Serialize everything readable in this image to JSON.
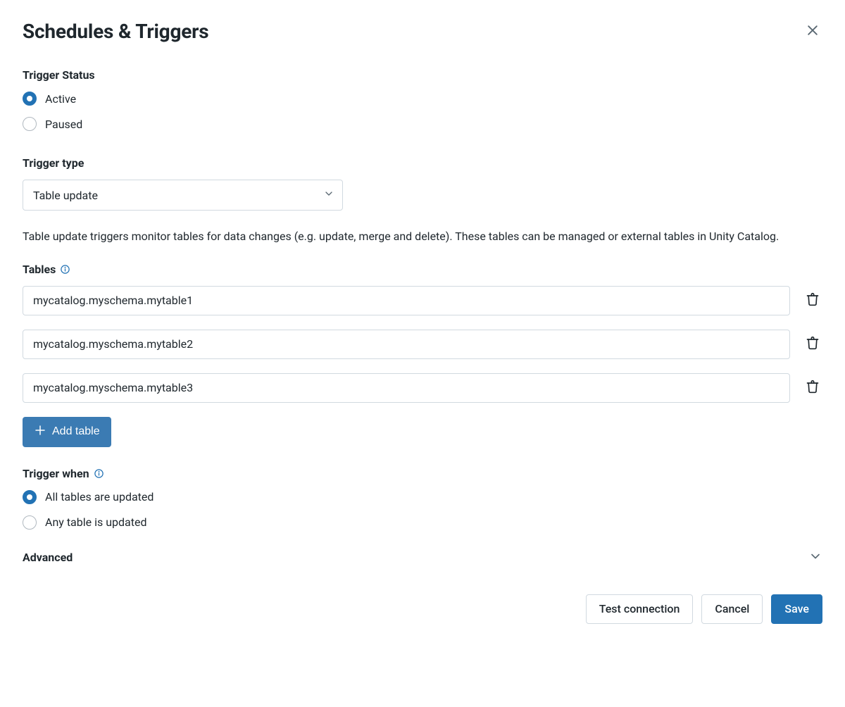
{
  "header": {
    "title": "Schedules & Triggers"
  },
  "trigger_status": {
    "label": "Trigger Status",
    "options": {
      "active": "Active",
      "paused": "Paused"
    },
    "selected": "active"
  },
  "trigger_type": {
    "label": "Trigger type",
    "selected": "Table update"
  },
  "description": "Table update triggers monitor tables for data changes (e.g. update, merge and delete). These tables can be managed or external tables in Unity Catalog.",
  "tables": {
    "label": "Tables",
    "rows": [
      "mycatalog.myschema.mytable1",
      "mycatalog.myschema.mytable2",
      "mycatalog.myschema.mytable3"
    ],
    "add_label": "Add table"
  },
  "trigger_when": {
    "label": "Trigger when",
    "options": {
      "all": "All tables are updated",
      "any": "Any table is updated"
    },
    "selected": "all"
  },
  "advanced": {
    "label": "Advanced"
  },
  "footer": {
    "test": "Test connection",
    "cancel": "Cancel",
    "save": "Save"
  }
}
